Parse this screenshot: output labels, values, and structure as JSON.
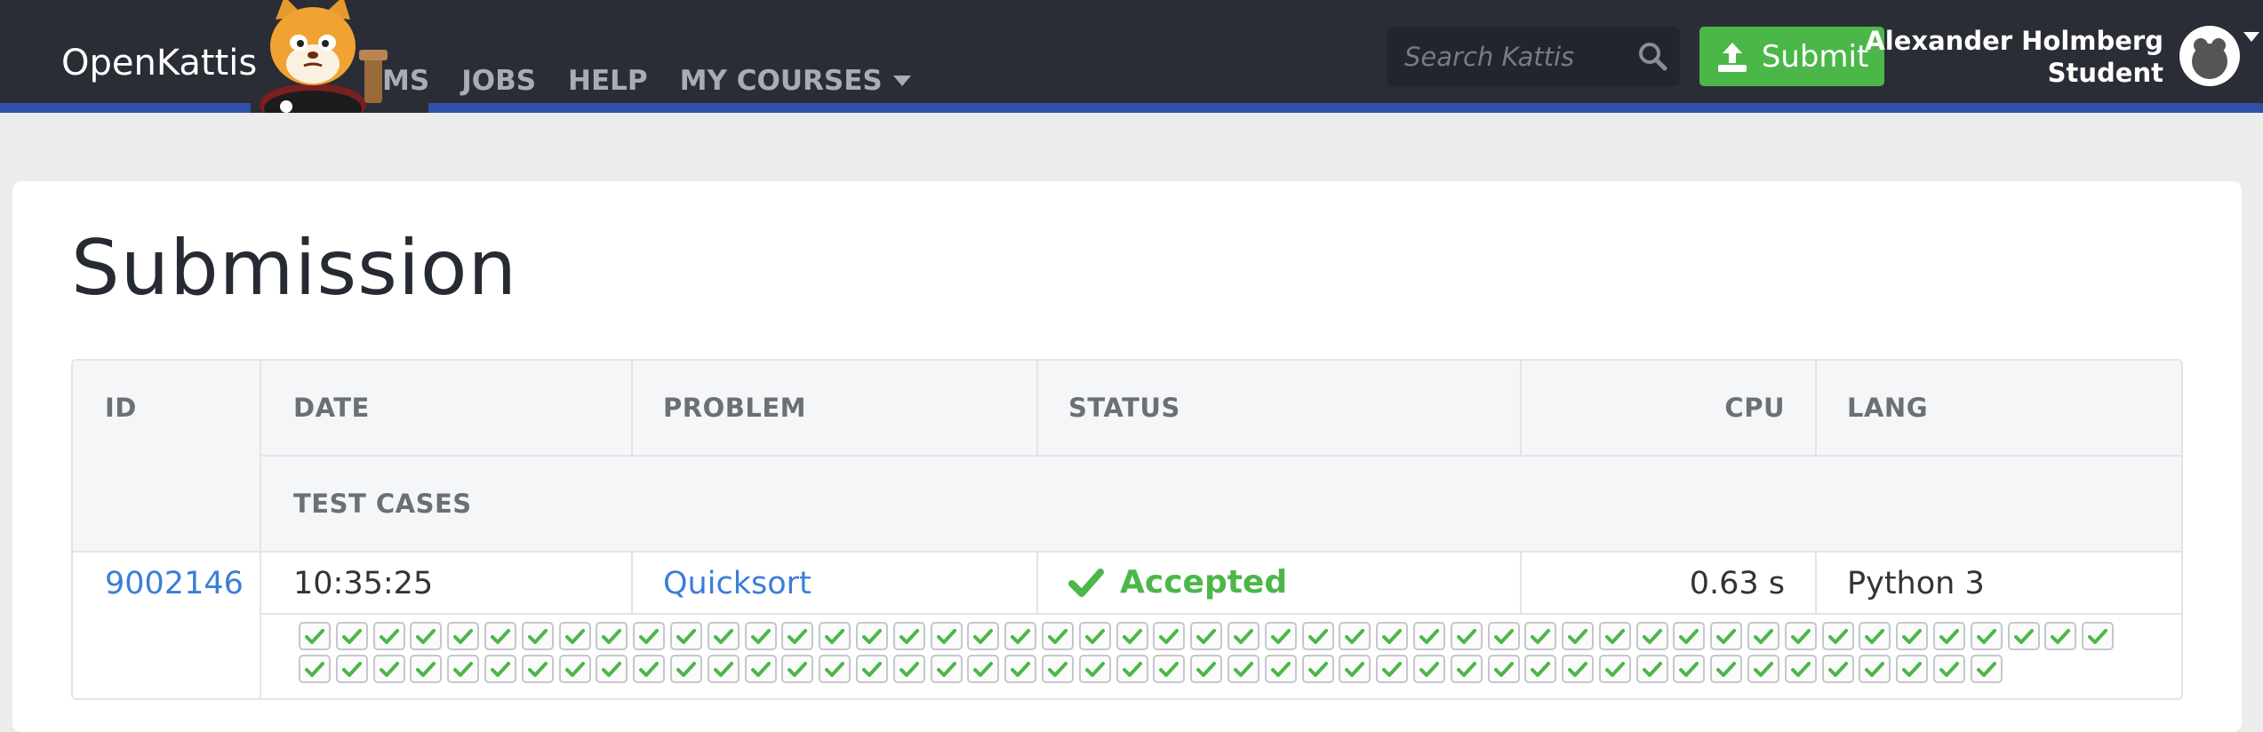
{
  "nav": {
    "brand": "OpenKattis",
    "links": [
      {
        "label": "MS"
      },
      {
        "label": "JOBS"
      },
      {
        "label": "HELP"
      },
      {
        "label": "MY COURSES"
      }
    ],
    "search_placeholder": "Search Kattis",
    "submit_label": "Submit",
    "user_name": "Alexander Holmberg",
    "user_role": "Student"
  },
  "page": {
    "title": "Submission"
  },
  "table": {
    "headers": {
      "id": "ID",
      "date": "DATE",
      "problem": "PROBLEM",
      "status": "STATUS",
      "cpu": "CPU",
      "lang": "LANG",
      "test_cases": "TEST CASES"
    },
    "row": {
      "id": "9002146",
      "date": "10:35:25",
      "problem": "Quicksort",
      "status": "Accepted",
      "cpu": "0.63 s",
      "lang": "Python 3"
    },
    "test_cases": {
      "row1_count": 49,
      "row2_count": 46,
      "all_passed": true
    }
  },
  "colors": {
    "accent": "#4cb749",
    "nav_bg": "#2a2d35",
    "nav_border": "#2f52a8",
    "link": "#3b7dd8"
  }
}
